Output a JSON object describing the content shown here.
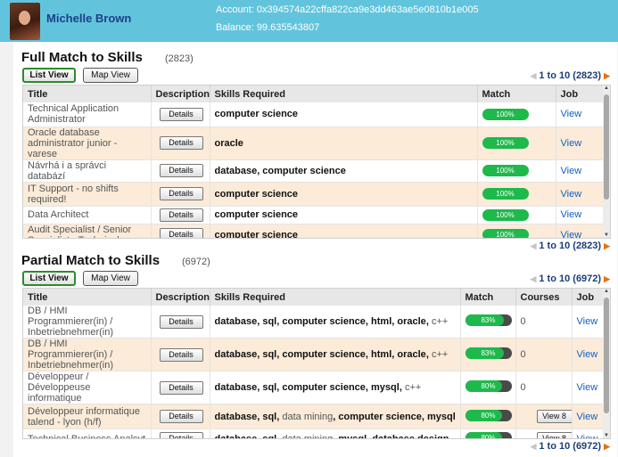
{
  "header": {
    "user_name": "Michelle Brown",
    "account": "Account: 0x394574a22cffa822ca9e3dd463ae5e0810b1e005",
    "balance": "Balance: 99.635543807"
  },
  "full_match": {
    "title": "Full Match to Skills",
    "count": "(2823)",
    "list_view_label": "List View",
    "map_view_label": "Map View",
    "pager_top": "1 to 10 (2823)",
    "pager_bottom": "1 to 10 (2823)",
    "columns": [
      "Title",
      "Description",
      "Skills Required",
      "Match",
      "Job"
    ],
    "rows": [
      {
        "title": "Technical Application Administrator",
        "details": "Details",
        "skills": "computer science",
        "match": "100%",
        "match_level": 100,
        "job": "View"
      },
      {
        "title": "Oracle database administrator junior - varese",
        "details": "Details",
        "skills": "oracle",
        "match": "100%",
        "match_level": 100,
        "job": "View"
      },
      {
        "title": "Návrhá i a správci databází",
        "details": "Details",
        "skills": "database, computer science",
        "match": "100%",
        "match_level": 100,
        "job": "View"
      },
      {
        "title": "IT Support - no shifts required!",
        "details": "Details",
        "skills": "computer science",
        "match": "100%",
        "match_level": 100,
        "job": "View"
      },
      {
        "title": "Data Architect",
        "details": "Details",
        "skills": "computer science",
        "match": "100%",
        "match_level": 100,
        "job": "View"
      },
      {
        "title": "Audit Specialist / Senior Specialist - Technical",
        "details": "Details",
        "skills": "computer science",
        "match": "100%",
        "match_level": 100,
        "job": "View"
      }
    ]
  },
  "partial_match": {
    "title": "Partial Match to Skills",
    "count": "(6972)",
    "list_view_label": "List View",
    "map_view_label": "Map View",
    "pager_top": "1 to 10 (6972)",
    "pager_bottom": "1 to 10 (6972)",
    "columns": [
      "Title",
      "Description",
      "Skills Required",
      "Match",
      "Courses",
      "Job"
    ],
    "rows": [
      {
        "title": "DB / HMI Programmierer(in) / Inbetriebnehmer(in)",
        "details": "Details",
        "skills_html": "<b>database</b>, <b>sql</b>, <b>computer science</b>, <b>html</b>, <b>oracle</b>, <span class=\"plain\">c++</span>",
        "match": "83%",
        "match_level": 83,
        "courses": "0",
        "job": "View"
      },
      {
        "title": "DB / HMI Programmierer(in) / Inbetriebnehmer(in)",
        "details": "Details",
        "skills_html": "<b>database</b>, <b>sql</b>, <b>computer science</b>, <b>html</b>, <b>oracle</b>, <span class=\"plain\">c++</span>",
        "match": "83%",
        "match_level": 83,
        "courses": "0",
        "job": "View"
      },
      {
        "title": "Développeur / Développeuse informatique",
        "details": "Details",
        "skills_html": "<b>database</b>, <b>sql</b>, <b>computer science</b>, <b>mysql</b>, <span class=\"plain\">c++</span>",
        "match": "80%",
        "match_level": 80,
        "courses": "0",
        "job": "View"
      },
      {
        "title": "Développeur informatique talend - lyon (h/f)",
        "details": "Details",
        "skills_html": "<b>database</b>, <b>sql</b>, <span class=\"plain\">data mining</span>, <b>computer science</b>, <b>mysql</b>",
        "match": "80%",
        "match_level": 80,
        "courses": "View 8",
        "job": "View"
      },
      {
        "title": "Technical Business Analsyt",
        "details": "Details",
        "skills_html": "<b>database</b>, <b>sql</b>, <span class=\"plain\">data mining</span>, <b>mysql</b>, <b>database design</b>",
        "match": "80%",
        "match_level": 80,
        "courses": "View 8",
        "job": "View"
      }
    ]
  },
  "icons": {
    "prev": "arrow-left-icon",
    "next": "arrow-right-icon"
  },
  "colors": {
    "header": "#62c4dc",
    "match_green": "#1db94b",
    "row_alt": "#fbebd8",
    "link": "#1060c8"
  }
}
